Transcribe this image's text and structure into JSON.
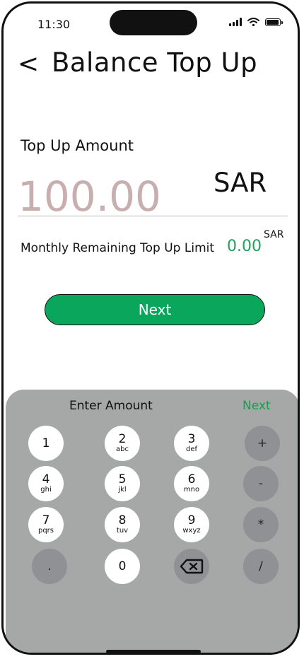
{
  "status_bar": {
    "time": "11:30"
  },
  "header": {
    "back_icon": "<",
    "title": "Balance Top Up"
  },
  "amount": {
    "label": "Top Up Amount",
    "placeholder": "100.00",
    "currency": "SAR"
  },
  "limit": {
    "label": "Monthly Remaining Top Up Limit",
    "value": "0.00",
    "currency": "SAR"
  },
  "next_button": {
    "label": "Next"
  },
  "keypad": {
    "title": "Enter Amount",
    "next_label": "Next",
    "keys": {
      "k1": {
        "num": "1",
        "letters": ""
      },
      "k2": {
        "num": "2",
        "letters": "abc"
      },
      "k3": {
        "num": "3",
        "letters": "def"
      },
      "k4": {
        "num": "4",
        "letters": "ghi"
      },
      "k5": {
        "num": "5",
        "letters": "jkl"
      },
      "k6": {
        "num": "6",
        "letters": "mno"
      },
      "k7": {
        "num": "7",
        "letters": "pqrs"
      },
      "k8": {
        "num": "8",
        "letters": "tuv"
      },
      "k9": {
        "num": "9",
        "letters": "wxyz"
      },
      "k0": {
        "num": "0",
        "letters": ""
      },
      "plus": "+",
      "minus": "-",
      "multiply": "*",
      "dot": ".",
      "divide": "/"
    }
  },
  "colors": {
    "accent_green": "#0aa65b",
    "keypad_bg": "#a6a8a8",
    "placeholder": "#c8aeae"
  }
}
